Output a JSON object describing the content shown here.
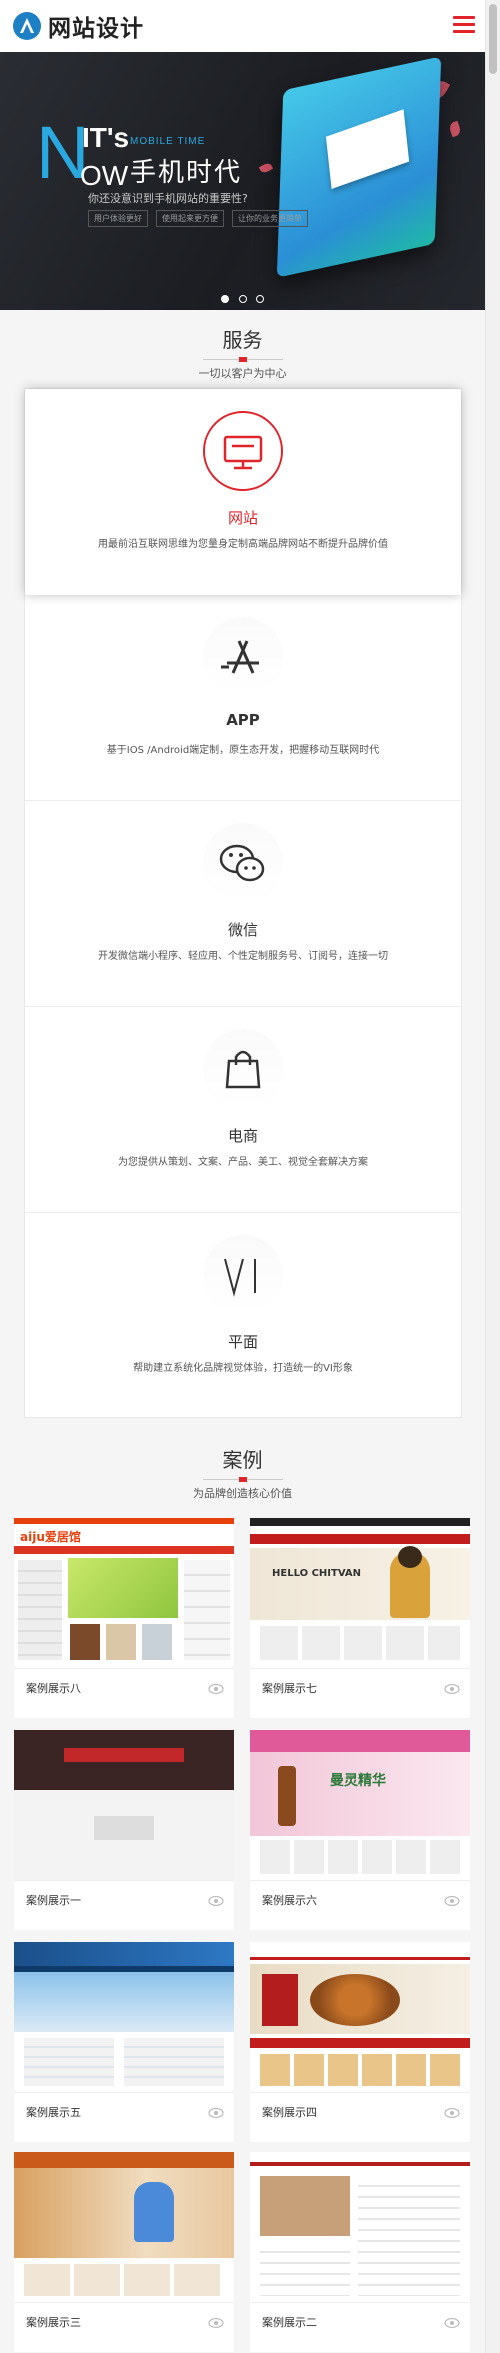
{
  "header": {
    "logo_text": "网站设计",
    "logo_icon": "triangle-logo-icon",
    "menu_icon": "hamburger-menu-icon",
    "accent_color": "#e0242a"
  },
  "banner": {
    "big_letter": "N",
    "its": "IT's",
    "ow": "OW",
    "mobile_time": "MOBILE TIME",
    "headline": "手机时代",
    "question": "你还没意识到手机网站的重要性?",
    "tags": [
      "用户体验更好",
      "使用起来更方便",
      "让你的业务更简单"
    ],
    "slides": 3,
    "active_slide": 1
  },
  "services": {
    "title": "服务",
    "subtitle": "一切以客户为中心",
    "items": [
      {
        "name": "网站",
        "desc": "用最前沿互联网思维为您量身定制高端品牌网站不断提升品牌价值",
        "icon": "monitor-icon"
      },
      {
        "name": "APP",
        "desc": "基于IOS /Android端定制，原生态开发，把握移动互联网时代",
        "icon": "app-store-icon"
      },
      {
        "name": "微信",
        "desc": "开发微信端小程序、轻应用、个性定制服务号、订阅号，连接一切",
        "icon": "wechat-icon"
      },
      {
        "name": "电商",
        "desc": "为您提供从策划、文案、产品、美工、视觉全套解决方案",
        "icon": "shopping-bag-icon"
      },
      {
        "name": "平面",
        "desc": "帮助建立系统化品牌视觉体验，打造统一的VI形象",
        "icon": "vi-icon"
      }
    ]
  },
  "cases": {
    "title": "案例",
    "subtitle": "为品牌创造核心价值",
    "items": [
      {
        "caption": "案例展示八",
        "theme": "aiju",
        "brand": "aiju爱居馆"
      },
      {
        "caption": "案例展示七",
        "theme": "chitvan",
        "brand": "HELLO CHITVAN"
      },
      {
        "caption": "案例展示一",
        "theme": "red-store",
        "brand": ""
      },
      {
        "caption": "案例展示六",
        "theme": "cosmetics",
        "brand": "曼灵精华"
      },
      {
        "caption": "案例展示五",
        "theme": "school",
        "brand": ""
      },
      {
        "caption": "案例展示四",
        "theme": "food",
        "brand": ""
      },
      {
        "caption": "案例展示三",
        "theme": "medical",
        "brand": ""
      },
      {
        "caption": "案例展示二",
        "theme": "portal",
        "brand": ""
      }
    ]
  }
}
